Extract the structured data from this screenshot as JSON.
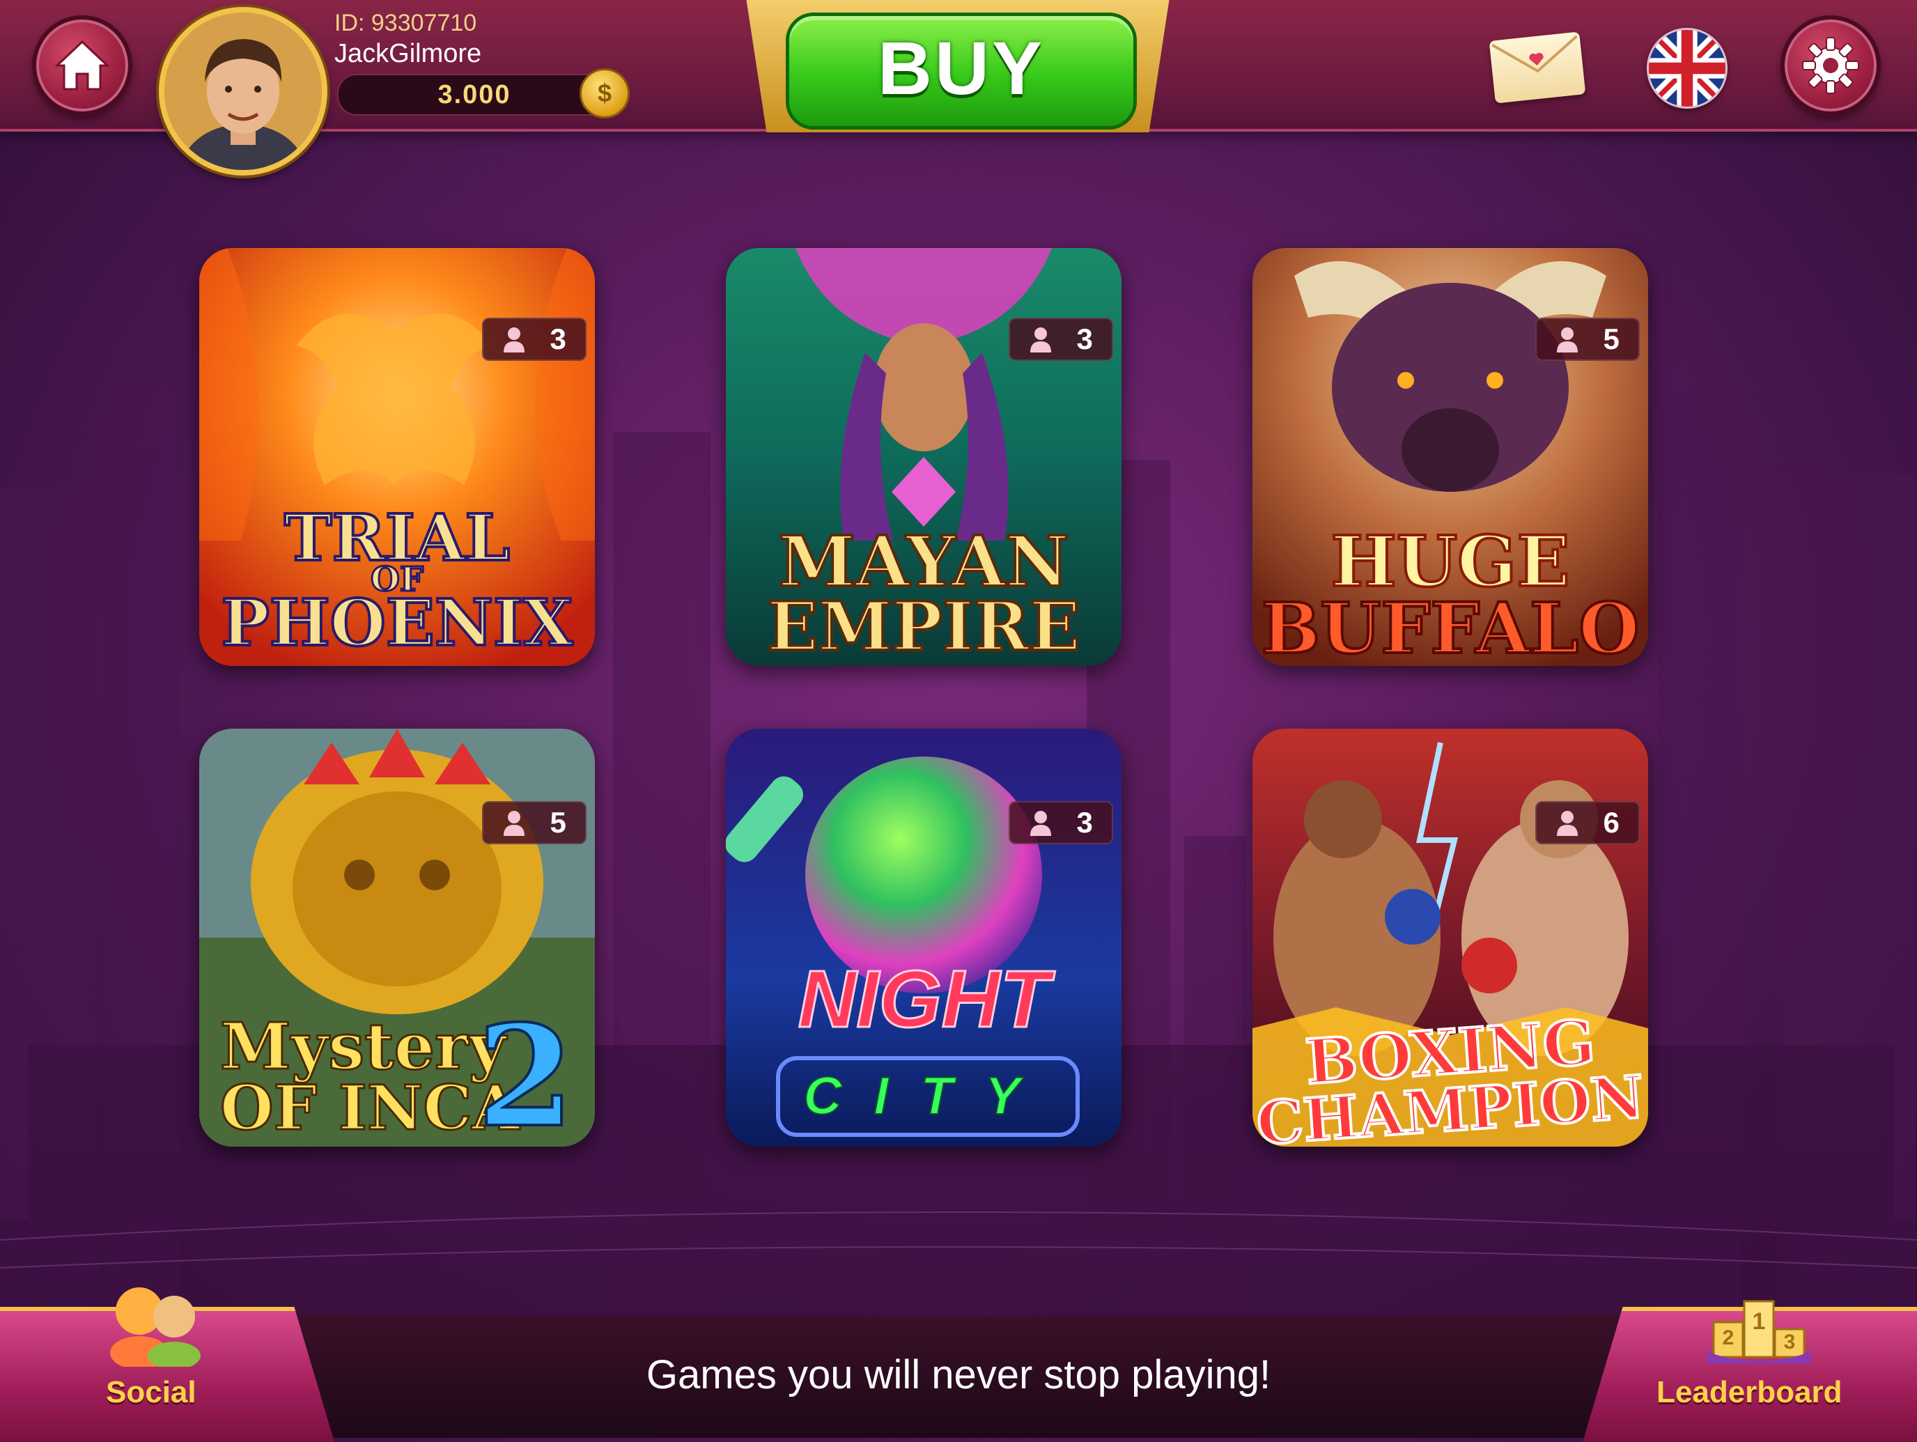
{
  "header": {
    "user_id": "ID: 93307710",
    "username": "JackGilmore",
    "balance": "3.000",
    "buy_label": "BUY",
    "home_icon": "home-icon",
    "mail_icon": "mail-icon",
    "language_icon": "uk-flag-icon",
    "settings_icon": "gear-icon"
  },
  "games": [
    {
      "title_line1": "TRIAL",
      "title_line2": "OF",
      "title_line3": "PHOENIX",
      "players": "3"
    },
    {
      "title_line1": "MAYAN",
      "title_line2": "EMPIRE",
      "players": "3"
    },
    {
      "title_line1": "HUGE",
      "title_line2": "BUFFALO",
      "players": "5"
    },
    {
      "title_line1": "Mystery",
      "title_line2": "OF INCA",
      "title_num": "2",
      "players": "5"
    },
    {
      "title_line1": "NIGHT",
      "title_line2": "CITY",
      "players": "3"
    },
    {
      "title_line1": "BOXING",
      "title_line2": "CHAMPION",
      "players": "6"
    }
  ],
  "footer": {
    "tagline": "Games you will never stop playing!",
    "social_label": "Social",
    "leaderboard_label": "Leaderboard"
  },
  "colors": {
    "accent_gold": "#f2c24a",
    "buy_green": "#36c81a",
    "topbar": "#8a2547",
    "background": "#5a1c5e"
  }
}
